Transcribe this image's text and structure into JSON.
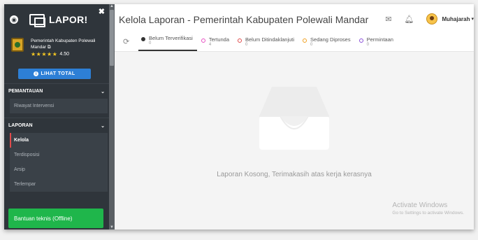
{
  "sidebar": {
    "logo_text": "LAPOR!",
    "agency_name": "Pemerintah Kabupaten Polewali Mandar",
    "rating_stars": "★★★★★",
    "rating_value": "4.50",
    "total_button": "LIHAT TOTAL",
    "sections": [
      {
        "title": "PEMANTAUAN",
        "items": [
          {
            "label": "Riwayat Intervensi"
          }
        ]
      },
      {
        "title": "LAPORAN",
        "items": [
          {
            "label": "Kelola"
          },
          {
            "label": "Terdisposisi"
          },
          {
            "label": "Arsip"
          },
          {
            "label": "Terlempar"
          }
        ]
      }
    ],
    "help_button": "Bantuan teknis (Offline)"
  },
  "header": {
    "title": "Kelola Laporan - Pemerintah Kabupaten Polewali Mandar",
    "user_name": "Muhajarah"
  },
  "tabs": [
    {
      "label": "Belum Terverifikasi",
      "count": "0",
      "color": "#333333"
    },
    {
      "label": "Tertunda",
      "count": "4",
      "color": "#e84fc3"
    },
    {
      "label": "Belum Ditindaklanjuti",
      "count": "0",
      "color": "#e04b4b"
    },
    {
      "label": "Sedang Diproses",
      "count": "0",
      "color": "#f0a020"
    },
    {
      "label": "Permintaan",
      "count": "0",
      "color": "#8a4fd8"
    }
  ],
  "main": {
    "empty_message": "Laporan Kosong, Terimakasih atas kerja kerasnya"
  },
  "watermark": {
    "title": "Activate Windows",
    "subtitle": "Go to Settings to activate Windows."
  },
  "colors": {
    "sidebar_bg": "#2f353b",
    "primary_button": "#2d7fd6",
    "help_button": "#1fb64b",
    "active_marker": "#e04b4b"
  }
}
